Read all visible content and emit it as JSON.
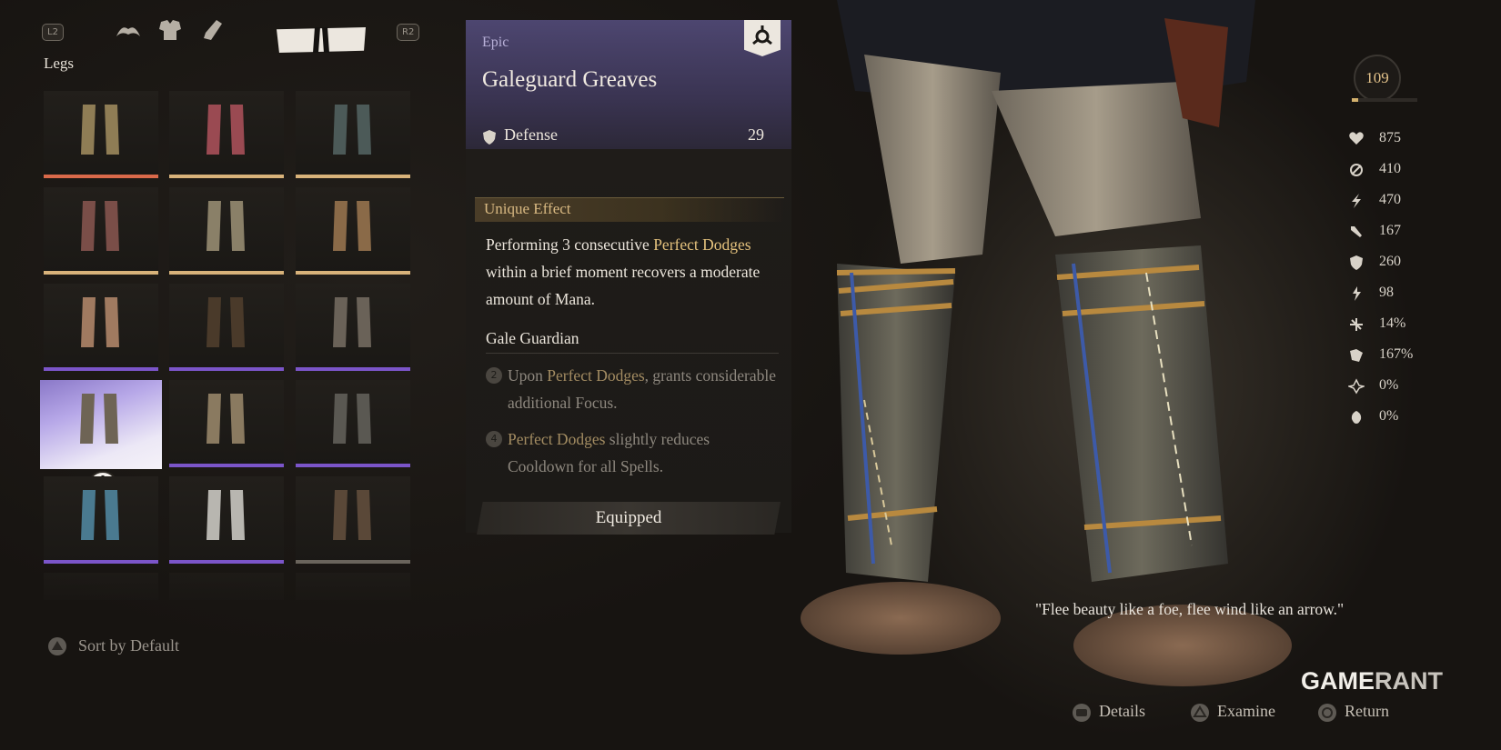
{
  "top_bar": {
    "left_trigger": "L2",
    "right_trigger": "R2",
    "category_icons": [
      "horns-icon",
      "chest-armor-icon",
      "arm-armor-icon",
      "legs-armor-icon"
    ]
  },
  "category_label": "Legs",
  "inventory": {
    "slots": [
      {
        "rarity_color": "#d9694a"
      },
      {
        "rarity_color": "#d8b27a"
      },
      {
        "rarity_color": "#d8b27a"
      },
      {
        "rarity_color": "#d8b27a"
      },
      {
        "rarity_color": "#d8b27a"
      },
      {
        "rarity_color": "#d8b27a"
      },
      {
        "rarity_color": "#7b55c9"
      },
      {
        "rarity_color": "#7b55c9"
      },
      {
        "rarity_color": "#7b55c9"
      },
      {
        "rarity_color": "#7b55c9",
        "selected": true
      },
      {
        "rarity_color": "#7b55c9"
      },
      {
        "rarity_color": "#7b55c9"
      },
      {
        "rarity_color": "#7b55c9"
      },
      {
        "rarity_color": "#7b55c9"
      },
      {
        "rarity_color": "#6a645c"
      }
    ]
  },
  "sort_label": "Sort by Default",
  "item": {
    "rarity": "Epic",
    "name": "Galeguard Greaves",
    "defense_label": "Defense",
    "defense_value": "29",
    "unique_effect_title": "Unique Effect",
    "desc_part1": "Performing 3 consecutive ",
    "desc_hl1": "Perfect Dodges",
    "desc_part2": " within a brief moment recovers a moderate amount of Mana.",
    "set_name": "Gale Guardian",
    "set_bonus_1_num": "2",
    "set_bonus_1_pre": "Upon ",
    "set_bonus_1_hl": "Perfect Dodges",
    "set_bonus_1_post": ", grants considerable additional Focus.",
    "set_bonus_2_num": "4",
    "set_bonus_2_hl": "Perfect Dodges",
    "set_bonus_2_post": " slightly reduces Cooldown for all Spells.",
    "equipped_label": "Equipped"
  },
  "player": {
    "level": "109",
    "xp_fraction": 0.1,
    "stats": [
      {
        "icon": "heart-icon",
        "value": "875"
      },
      {
        "icon": "mana-icon",
        "value": "410"
      },
      {
        "icon": "stamina-icon",
        "value": "470"
      },
      {
        "icon": "attack-icon",
        "value": "167"
      },
      {
        "icon": "defense-icon",
        "value": "260"
      },
      {
        "icon": "crit-icon",
        "value": "98"
      },
      {
        "icon": "crit-chance-icon",
        "value": "14%"
      },
      {
        "icon": "crit-damage-icon",
        "value": "167%"
      },
      {
        "icon": "resist-icon",
        "value": "0%"
      },
      {
        "icon": "damage-bonus-icon",
        "value": "0%"
      }
    ]
  },
  "quote": "\"Flee beauty like a foe, flee wind like an arrow.\"",
  "brand": {
    "part1": "GAME",
    "part2": "RANT"
  },
  "hints": {
    "details": "Details",
    "examine": "Examine",
    "return": "Return"
  }
}
